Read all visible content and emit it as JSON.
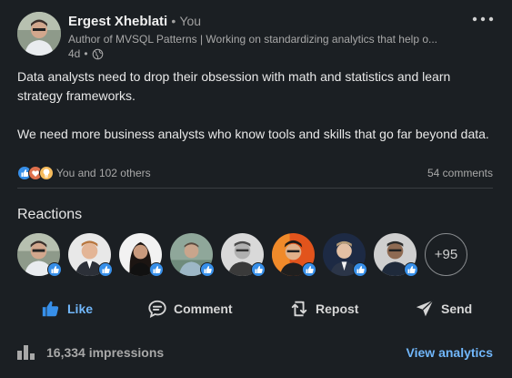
{
  "author": {
    "name": "Ergest Xheblati",
    "separator": "•",
    "relation": "You",
    "headline": "Author of MVSQL Patterns | Working on standardizing analytics that help o...",
    "age": "4d",
    "meta_separator": "•",
    "visibility_icon": "globe-icon",
    "more_icon": "more-dots-icon"
  },
  "post": {
    "paragraphs": [
      "Data analysts need to drop their obsession with math and statistics and learn strategy frameworks.",
      "We need more business analysts who know tools and skills that go far beyond data."
    ]
  },
  "social": {
    "reaction_icons": [
      "like-icon",
      "love-icon",
      "insightful-icon"
    ],
    "reactions_text": "You and 102 others",
    "comments": "54 comments"
  },
  "reactions": {
    "title": "Reactions",
    "people": [
      {
        "name": "reactor-1",
        "reaction": "like-icon"
      },
      {
        "name": "reactor-2",
        "reaction": "like-icon"
      },
      {
        "name": "reactor-3",
        "reaction": "like-icon"
      },
      {
        "name": "reactor-4",
        "reaction": "like-icon"
      },
      {
        "name": "reactor-5",
        "reaction": "like-icon"
      },
      {
        "name": "reactor-6",
        "reaction": "like-icon"
      },
      {
        "name": "reactor-7",
        "reaction": "like-icon"
      },
      {
        "name": "reactor-8",
        "reaction": "like-icon"
      }
    ],
    "more": "+95"
  },
  "actions": {
    "like": "Like",
    "comment": "Comment",
    "repost": "Repost",
    "send": "Send"
  },
  "footer": {
    "impressions": "16,334 impressions",
    "analytics": "View analytics"
  },
  "colors": {
    "background": "#1b1f23",
    "link": "#71b7fb",
    "like_blue": "#378fe9"
  }
}
